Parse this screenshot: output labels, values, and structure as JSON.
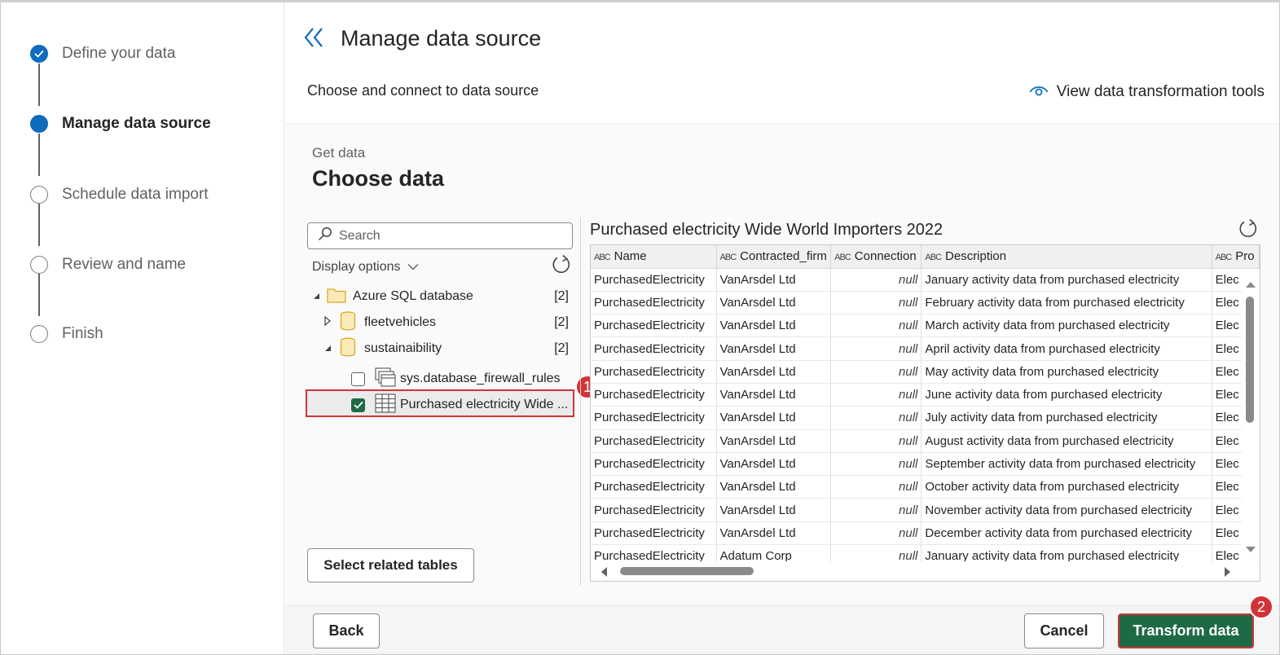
{
  "steps": [
    {
      "label": "Define your data",
      "state": "done"
    },
    {
      "label": "Manage data source",
      "state": "current"
    },
    {
      "label": "Schedule data import",
      "state": "pending"
    },
    {
      "label": "Review and name",
      "state": "pending"
    },
    {
      "label": "Finish",
      "state": "pending"
    }
  ],
  "header": {
    "title": "Manage data source",
    "subtitle": "Choose and connect to data source",
    "view_tools_label": "View data transformation tools"
  },
  "get_data": {
    "eyebrow": "Get data",
    "title": "Choose data"
  },
  "navigator": {
    "search_placeholder": "Search",
    "display_options": "Display options",
    "tree": [
      {
        "label": "Azure SQL database",
        "count": "[2]",
        "icon": "folder-icon",
        "expanded": true
      },
      {
        "label": "fleetvehicles",
        "count": "[2]",
        "icon": "database-icon",
        "expanded": false
      },
      {
        "label": "sustainaibility",
        "count": "[2]",
        "icon": "database-icon",
        "expanded": true
      },
      {
        "label": "sys.database_firewall_rules",
        "icon": "view-icon",
        "checked": false
      },
      {
        "label": "Purchased electricity Wide ...",
        "icon": "table-icon",
        "checked": true
      }
    ],
    "select_related_label": "Select related tables"
  },
  "callouts": {
    "one": "1",
    "two": "2"
  },
  "preview": {
    "title": "Purchased electricity Wide World Importers 2022",
    "type_glyph": "ABC",
    "columns": [
      "Name",
      "Contracted_firm",
      "Connection",
      "Description",
      "Pro"
    ],
    "rows": [
      [
        "PurchasedElectricity",
        "VanArsdel Ltd",
        "null",
        "January activity data from purchased electricity",
        "Elec"
      ],
      [
        "PurchasedElectricity",
        "VanArsdel Ltd",
        "null",
        "February activity data from purchased electricity",
        "Elec"
      ],
      [
        "PurchasedElectricity",
        "VanArsdel Ltd",
        "null",
        "March activity data from purchased electricity",
        "Elec"
      ],
      [
        "PurchasedElectricity",
        "VanArsdel Ltd",
        "null",
        "April activity data from purchased electricity",
        "Elec"
      ],
      [
        "PurchasedElectricity",
        "VanArsdel Ltd",
        "null",
        "May activity data from purchased electricity",
        "Elec"
      ],
      [
        "PurchasedElectricity",
        "VanArsdel Ltd",
        "null",
        "June activity data from purchased electricity",
        "Elec"
      ],
      [
        "PurchasedElectricity",
        "VanArsdel Ltd",
        "null",
        "July activity data from purchased electricity",
        "Elec"
      ],
      [
        "PurchasedElectricity",
        "VanArsdel Ltd",
        "null",
        "August activity data from purchased electricity",
        "Elec"
      ],
      [
        "PurchasedElectricity",
        "VanArsdel Ltd",
        "null",
        "September activity data from purchased electricity",
        "Elec"
      ],
      [
        "PurchasedElectricity",
        "VanArsdel Ltd",
        "null",
        "October activity data from purchased electricity",
        "Elec"
      ],
      [
        "PurchasedElectricity",
        "VanArsdel Ltd",
        "null",
        "November activity data from purchased electricity",
        "Elec"
      ],
      [
        "PurchasedElectricity",
        "VanArsdel Ltd",
        "null",
        "December activity data from purchased electricity",
        "Elec"
      ],
      [
        "PurchasedElectricity",
        "Adatum Corp",
        "null",
        "January activity data from purchased electricity",
        "Elec"
      ]
    ]
  },
  "footer": {
    "back_label": "Back",
    "cancel_label": "Cancel",
    "transform_label": "Transform data"
  },
  "colors": {
    "accent": "#0f6cbd",
    "primary_button": "#1e6a45",
    "callout": "#d13438"
  }
}
